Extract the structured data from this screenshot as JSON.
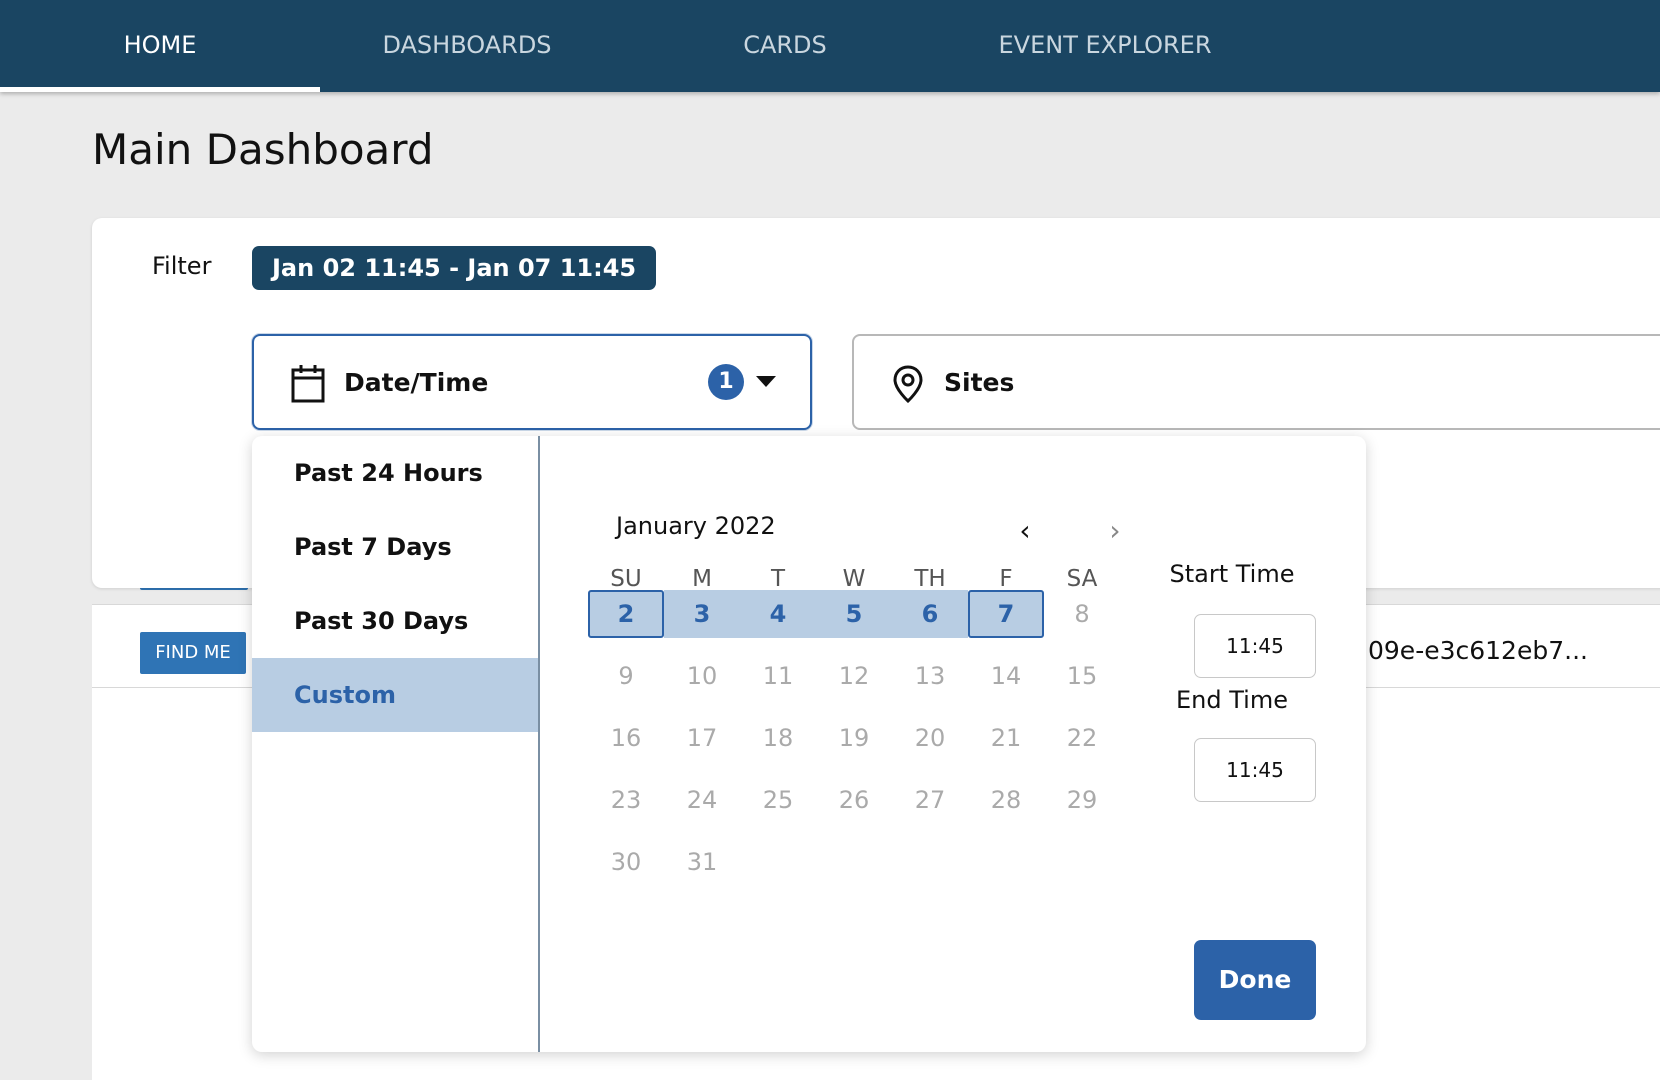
{
  "nav": {
    "tabs": [
      {
        "label": "HOME",
        "active": true
      },
      {
        "label": "DASHBOARDS",
        "active": false
      },
      {
        "label": "CARDS",
        "active": false
      },
      {
        "label": "EVENT EXPLORER",
        "active": false
      }
    ]
  },
  "page": {
    "title": "Main Dashboard"
  },
  "filter": {
    "label": "Filter",
    "chip": "Jan 02 11:45 - Jan 07 11:45",
    "datetime": {
      "label": "Date/Time",
      "badge": "1",
      "icon": "calendar-icon"
    },
    "sites": {
      "label": "Sites",
      "icon": "location-pin-icon"
    }
  },
  "table": {
    "find_me_label": "FIND ME",
    "row_id": "09e-e3c612eb7..."
  },
  "dropdown": {
    "presets": [
      {
        "label": "Past 24 Hours",
        "active": false
      },
      {
        "label": "Past 7 Days",
        "active": false
      },
      {
        "label": "Past 30 Days",
        "active": false
      },
      {
        "label": "Custom",
        "active": true
      }
    ],
    "calendar": {
      "month_label": "January 2022",
      "weekdays": [
        "SU",
        "M",
        "T",
        "W",
        "TH",
        "F",
        "SA"
      ],
      "range_start": 2,
      "range_end": 7,
      "weeks": [
        [
          "",
          "",
          "",
          "",
          "",
          "",
          ""
        ],
        [
          "2",
          "3",
          "4",
          "5",
          "6",
          "7",
          "8"
        ],
        [
          "9",
          "10",
          "11",
          "12",
          "13",
          "14",
          "15"
        ],
        [
          "16",
          "17",
          "18",
          "19",
          "20",
          "21",
          "22"
        ],
        [
          "23",
          "24",
          "25",
          "26",
          "27",
          "28",
          "29"
        ],
        [
          "30",
          "31",
          "",
          "",
          "",
          "",
          ""
        ]
      ]
    },
    "start_time_label": "Start Time",
    "start_time": "11:45",
    "end_time_label": "End Time",
    "end_time": "11:45",
    "done_label": "Done"
  },
  "colors": {
    "nav_bg": "#1a4562",
    "accent": "#2c62a8",
    "range_fill": "#b8cde3",
    "button_blue": "#2f74b5"
  }
}
